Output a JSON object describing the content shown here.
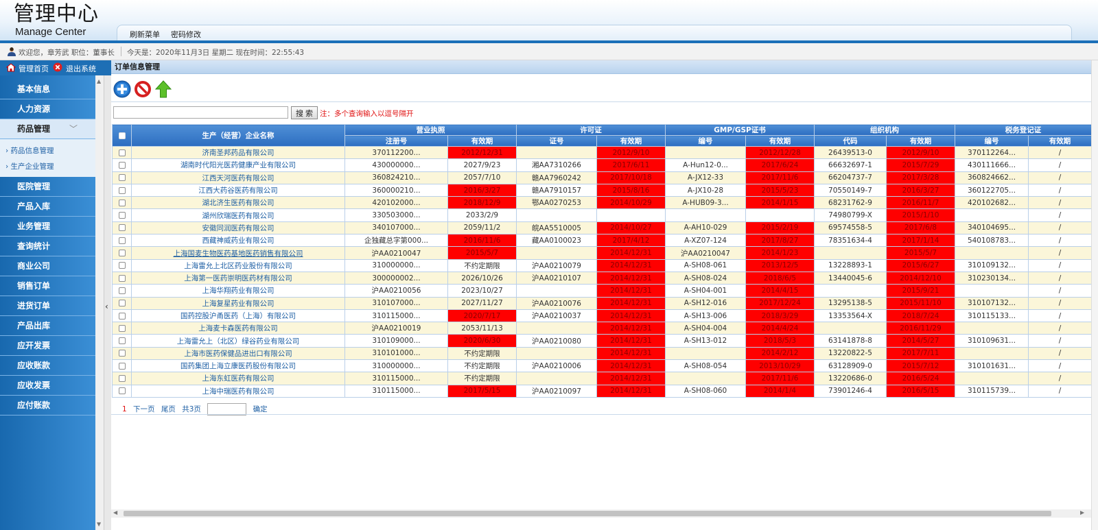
{
  "header": {
    "logo_cn": "管理中心",
    "logo_en": "Manage Center",
    "menu": [
      "刷新菜单",
      "密码修改"
    ]
  },
  "info": {
    "welcome": "欢迎您，章芳武  职位：董事长",
    "date": "今天是：2020年11月3日 星期二 现在时间：22:55:43"
  },
  "sidebar": {
    "home": "管理首页",
    "logout": "退出系统",
    "items": [
      "基本信息",
      "人力资源",
      "药品管理",
      "医院管理",
      "产品入库",
      "业务管理",
      "查询统计",
      "商业公司",
      "销售订单",
      "进货订单",
      "产品出库",
      "应开发票",
      "应收账款",
      "应收发票",
      "应付账款"
    ],
    "sub_items": [
      "药品信息管理",
      "生产企业管理"
    ]
  },
  "main": {
    "title": "订单信息管理",
    "search_placeholder": "",
    "search_btn": "搜 索",
    "search_note": "注：多个查询输入以逗号隔开"
  },
  "table": {
    "group_headers": [
      "生产（经营）企业名称",
      "营业执照",
      "许可证",
      "GMP/GSP证书",
      "组织机构",
      "税务登记证"
    ],
    "sub_headers": [
      "注册号",
      "有效期",
      "证号",
      "有效期",
      "编号",
      "有效期",
      "代码",
      "有效期",
      "编号",
      "有效期"
    ],
    "rows": [
      {
        "name": "济南圣邦药品有限公司",
        "c": [
          "370112200...",
          "2012/12/31",
          "",
          "2012/9/10",
          "",
          "2012/12/28",
          "26439513-0",
          "2012/9/10",
          "370112264...",
          "/"
        ],
        "red": [
          1,
          3,
          5,
          7
        ]
      },
      {
        "name": "湖南时代阳光医药健康产业有限公司",
        "c": [
          "430000000...",
          "2027/9/23",
          "湘AA7310266",
          "2017/6/11",
          "A-Hun12-0...",
          "2017/6/24",
          "66632697-1",
          "2015/7/29",
          "430111666...",
          "/"
        ],
        "red": [
          3,
          5,
          7
        ]
      },
      {
        "name": "江西天河医药有限公司",
        "c": [
          "360824210...",
          "2057/7/10",
          "赣AA7960242",
          "2017/10/18",
          "A-JX12-33",
          "2017/11/6",
          "66204737-7",
          "2017/3/28",
          "360824662...",
          "/"
        ],
        "red": [
          3,
          5,
          7
        ]
      },
      {
        "name": "江西大药谷医药有限公司",
        "c": [
          "360000210...",
          "2016/3/27",
          "赣AA7910157",
          "2015/8/16",
          "A-JX10-28",
          "2015/5/23",
          "70550149-7",
          "2016/3/27",
          "360122705...",
          "/"
        ],
        "red": [
          1,
          3,
          5,
          7
        ]
      },
      {
        "name": "湖北济生医药有限公司",
        "c": [
          "420102000...",
          "2018/12/9",
          "鄂AA0270253",
          "2014/10/29",
          "A-HUB09-3...",
          "2014/1/15",
          "68231762-9",
          "2016/11/7",
          "420102682...",
          "/"
        ],
        "red": [
          1,
          3,
          5,
          7
        ]
      },
      {
        "name": "湖州欣瑞医药有限公司",
        "c": [
          "330503000...",
          "2033/2/9",
          "",
          "",
          "",
          "",
          "74980799-X",
          "2015/1/10",
          "",
          "/"
        ],
        "red": [
          7
        ]
      },
      {
        "name": "安徽同润医药有限公司",
        "c": [
          "340107000...",
          "2059/11/2",
          "皖AA5510005",
          "2014/10/27",
          "A-AH10-029",
          "2015/2/19",
          "69574558-5",
          "2017/6/8",
          "340104695...",
          "/"
        ],
        "red": [
          3,
          5,
          7
        ]
      },
      {
        "name": "西藏神威药业有限公司",
        "c": [
          "企独藏总字第000...",
          "2016/11/6",
          "藏AA0100023",
          "2017/4/12",
          "A-XZ07-124",
          "2017/8/27",
          "78351634-4",
          "2017/1/14",
          "540108783...",
          "/"
        ],
        "red": [
          1,
          3,
          5,
          7
        ]
      },
      {
        "name": "上海国麦生物医药基地医药销售有限公司",
        "ul": true,
        "c": [
          "沪AA0210047",
          "2015/5/7",
          "",
          "2014/12/31",
          "沪AA0210047",
          "2014/1/23",
          "",
          "2015/5/7",
          "",
          "/"
        ],
        "red": [
          1,
          3,
          5,
          7
        ]
      },
      {
        "name": "上海雷允上北区药业股份有限公司",
        "c": [
          "310000000...",
          "不约定期限",
          "沪AA0210079",
          "2014/12/31",
          "A-SH08-061",
          "2013/12/5",
          "13228893-1",
          "2015/6/27",
          "310109132...",
          "/"
        ],
        "red": [
          3,
          5,
          7
        ]
      },
      {
        "name": "上海第一医药崇明医药材有限公司",
        "c": [
          "300000002...",
          "2026/10/26",
          "沪AA0210107",
          "2014/12/31",
          "A-SH08-024",
          "2018/6/5",
          "13440045-6",
          "2014/12/10",
          "310230134...",
          "/"
        ],
        "red": [
          3,
          5,
          7
        ]
      },
      {
        "name": "上海华翔药业有限公司",
        "c": [
          "沪AA0210056",
          "2023/10/27",
          "",
          "2014/12/31",
          "A-SH04-001",
          "2014/4/15",
          "",
          "2015/9/21",
          "",
          "/"
        ],
        "red": [
          3,
          5,
          7
        ]
      },
      {
        "name": "上海复星药业有限公司",
        "c": [
          "310107000...",
          "2027/11/27",
          "沪AA0210076",
          "2014/12/31",
          "A-SH12-016",
          "2017/12/24",
          "13295138-5",
          "2015/11/10",
          "310107132...",
          "/"
        ],
        "red": [
          3,
          5,
          7
        ]
      },
      {
        "name": "国药控股沪甬医药（上海）有限公司",
        "c": [
          "310115000...",
          "2020/7/17",
          "沪AA0210037",
          "2014/12/31",
          "A-SH13-006",
          "2018/3/29",
          "13353564-X",
          "2018/7/24",
          "310115133...",
          "/"
        ],
        "red": [
          1,
          3,
          5,
          7
        ]
      },
      {
        "name": "上海麦卡森医药有限公司",
        "c": [
          "沪AA0210019",
          "2053/11/13",
          "",
          "2014/12/31",
          "A-SH04-004",
          "2014/4/24",
          "",
          "2016/11/29",
          "",
          "/"
        ],
        "red": [
          3,
          5,
          7
        ]
      },
      {
        "name": "上海雷允上（北区）绿谷药业有限公司",
        "c": [
          "310109000...",
          "2020/6/30",
          "沪AA0210080",
          "2014/12/31",
          "A-SH13-012",
          "2018/5/3",
          "63141878-8",
          "2014/5/27",
          "310109631...",
          "/"
        ],
        "red": [
          1,
          3,
          5,
          7
        ]
      },
      {
        "name": "上海市医药保健品进出口有限公司",
        "c": [
          "310101000...",
          "不约定期限",
          "",
          "2014/12/31",
          "",
          "2014/2/12",
          "13220822-5",
          "2017/7/11",
          "",
          "/"
        ],
        "red": [
          3,
          5,
          7
        ]
      },
      {
        "name": "国药集团上海立康医药股份有限公司",
        "c": [
          "310000000...",
          "不约定期限",
          "沪AA0210006",
          "2014/12/31",
          "A-SH08-054",
          "2013/10/29",
          "63128909-0",
          "2015/7/12",
          "310101631...",
          "/"
        ],
        "red": [
          3,
          5,
          7
        ]
      },
      {
        "name": "上海东虹医药有限公司",
        "c": [
          "310115000...",
          "不约定期限",
          "",
          "2014/12/31",
          "",
          "2017/11/6",
          "13220686-0",
          "2016/5/24",
          "",
          "/"
        ],
        "red": [
          3,
          5,
          7
        ]
      },
      {
        "name": "上海中瑞医药有限公司",
        "c": [
          "310115000...",
          "2017/5/15",
          "沪AA0210097",
          "2014/12/31",
          "A-SH08-060",
          "2014/1/4",
          "73901246-4",
          "2016/5/15",
          "310115739...",
          "/"
        ],
        "red": [
          1,
          3,
          5,
          7
        ]
      }
    ]
  },
  "pager": {
    "current": "1",
    "next": "下一页",
    "last": "尾页",
    "total": "共3页",
    "confirm": "确定"
  },
  "colors": {
    "expired": "#ff0000",
    "header_blue": "#2c6dc0",
    "nav_blue": "#1868ae"
  }
}
